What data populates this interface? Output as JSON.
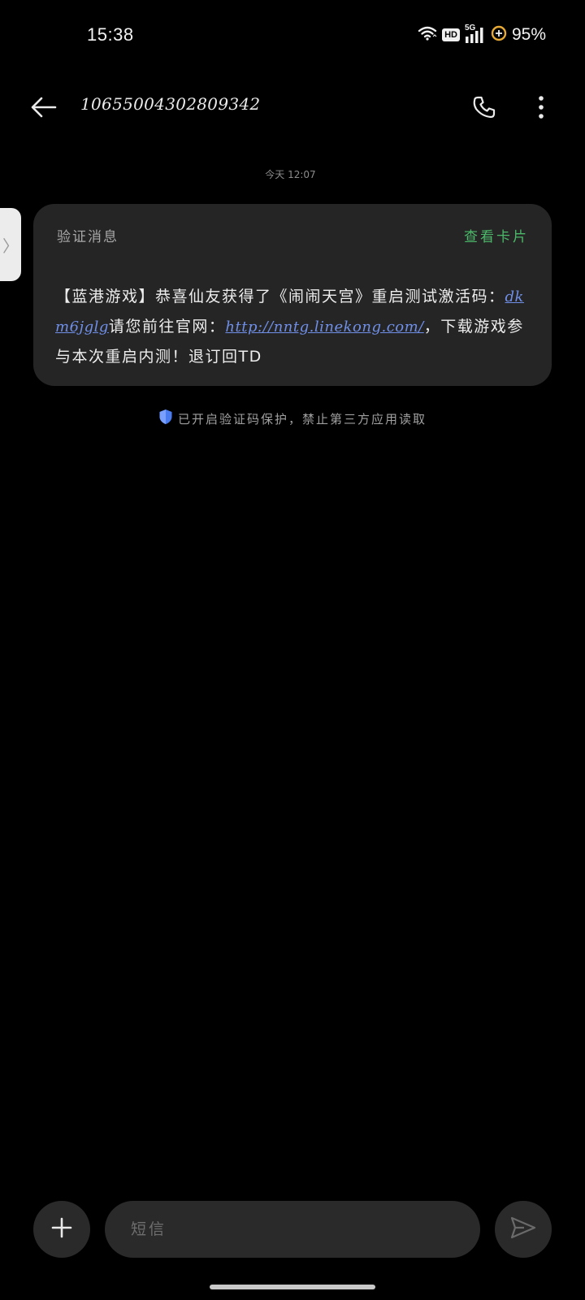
{
  "status_bar": {
    "time": "15:38",
    "hd_badge": "HD",
    "network": "5G",
    "battery_percent": "95%",
    "icons": [
      "wifi-icon",
      "hd-icon",
      "signal-5g-icon",
      "battery-saver-icon"
    ]
  },
  "header": {
    "contact_number": "10655004302809342",
    "icons": [
      "back-arrow-icon",
      "phone-icon",
      "more-vertical-icon"
    ]
  },
  "conversation": {
    "timestamp": "今天 12:07",
    "message": {
      "label": "验证消息",
      "card_link": "查看卡片",
      "body_part1": "【蓝港游戏】恭喜仙友获得了《闹闹天宫》重启测试激活码：",
      "code": "dkm6jglg",
      "body_part2": "请您前往官网：",
      "url": "http://nntg.linekong.com/",
      "body_part3": "，下载游戏参与本次重启内测！退订回TD"
    },
    "protection_note": "已开启验证码保护，禁止第三方应用读取"
  },
  "side_handle": {
    "glyph": "〉"
  },
  "composer": {
    "placeholder": "短信",
    "icons": [
      "plus-icon",
      "send-icon"
    ]
  },
  "colors": {
    "background": "#000000",
    "bubble": "#252525",
    "card_link": "#4cb86a",
    "link": "#6f8fe8",
    "shield": "#4a7cf0"
  }
}
